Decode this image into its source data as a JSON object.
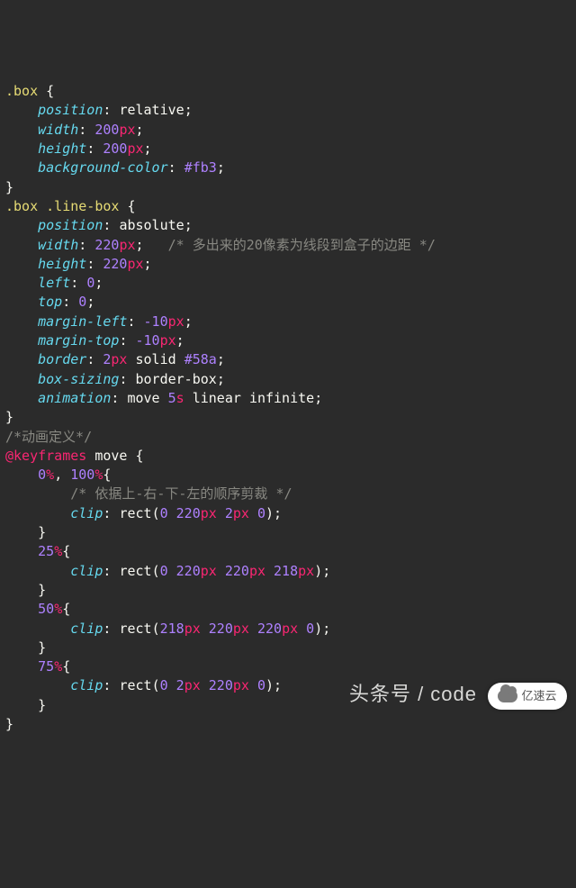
{
  "code": {
    "rule1": {
      "selector": ".box",
      "decls": [
        {
          "prop": "position",
          "value": "relative"
        },
        {
          "prop": "width",
          "number": "200",
          "unit": "px"
        },
        {
          "prop": "height",
          "number": "200",
          "unit": "px"
        },
        {
          "prop": "background-color",
          "value": "#fb3",
          "isColor": true
        }
      ]
    },
    "rule2": {
      "selector": ".box .line-box",
      "decls": [
        {
          "prop": "position",
          "value": "absolute"
        },
        {
          "prop": "width",
          "number": "220",
          "unit": "px",
          "trailingComment": "/* 多出来的20像素为线段到盒子的边距 */"
        },
        {
          "prop": "height",
          "number": "220",
          "unit": "px"
        },
        {
          "prop": "left",
          "number": "0"
        },
        {
          "prop": "top",
          "number": "0"
        },
        {
          "prop": "margin-left",
          "number": "-10",
          "unit": "px"
        },
        {
          "prop": "margin-top",
          "number": "-10",
          "unit": "px"
        },
        {
          "prop": "border",
          "parts": [
            {
              "n": "2",
              "u": "px"
            },
            {
              "v": "solid"
            },
            {
              "c": "#58a"
            }
          ]
        },
        {
          "prop": "box-sizing",
          "value": "border-box"
        },
        {
          "prop": "animation",
          "parts": [
            {
              "v": "move"
            },
            {
              "n": "5",
              "u": "s"
            },
            {
              "v": "linear"
            },
            {
              "v": "infinite"
            }
          ]
        }
      ]
    },
    "commentAnimDef": "/*动画定义*/",
    "keyframes": {
      "keyword": "@keyframes",
      "name": "move",
      "frames": [
        {
          "stops": [
            "0%",
            "100%"
          ],
          "innerComment": "/* 依据上-右-下-左的顺序剪裁 */",
          "decl": {
            "prop": "clip",
            "fn": "rect",
            "args": [
              {
                "n": "0"
              },
              {
                "n": "220",
                "u": "px"
              },
              {
                "n": "2",
                "u": "px"
              },
              {
                "n": "0"
              }
            ]
          }
        },
        {
          "stops": [
            "25%"
          ],
          "decl": {
            "prop": "clip",
            "fn": "rect",
            "args": [
              {
                "n": "0"
              },
              {
                "n": "220",
                "u": "px"
              },
              {
                "n": "220",
                "u": "px"
              },
              {
                "n": "218",
                "u": "px"
              }
            ]
          }
        },
        {
          "stops": [
            "50%"
          ],
          "decl": {
            "prop": "clip",
            "fn": "rect",
            "args": [
              {
                "n": "218",
                "u": "px"
              },
              {
                "n": "220",
                "u": "px"
              },
              {
                "n": "220",
                "u": "px"
              },
              {
                "n": "0"
              }
            ]
          }
        },
        {
          "stops": [
            "75%"
          ],
          "decl": {
            "prop": "clip",
            "fn": "rect",
            "args": [
              {
                "n": "0"
              },
              {
                "n": "2",
                "u": "px"
              },
              {
                "n": "220",
                "u": "px"
              },
              {
                "n": "0"
              }
            ]
          }
        }
      ]
    }
  },
  "watermark": {
    "text": "头条号 / code",
    "logoText": "亿速云"
  }
}
